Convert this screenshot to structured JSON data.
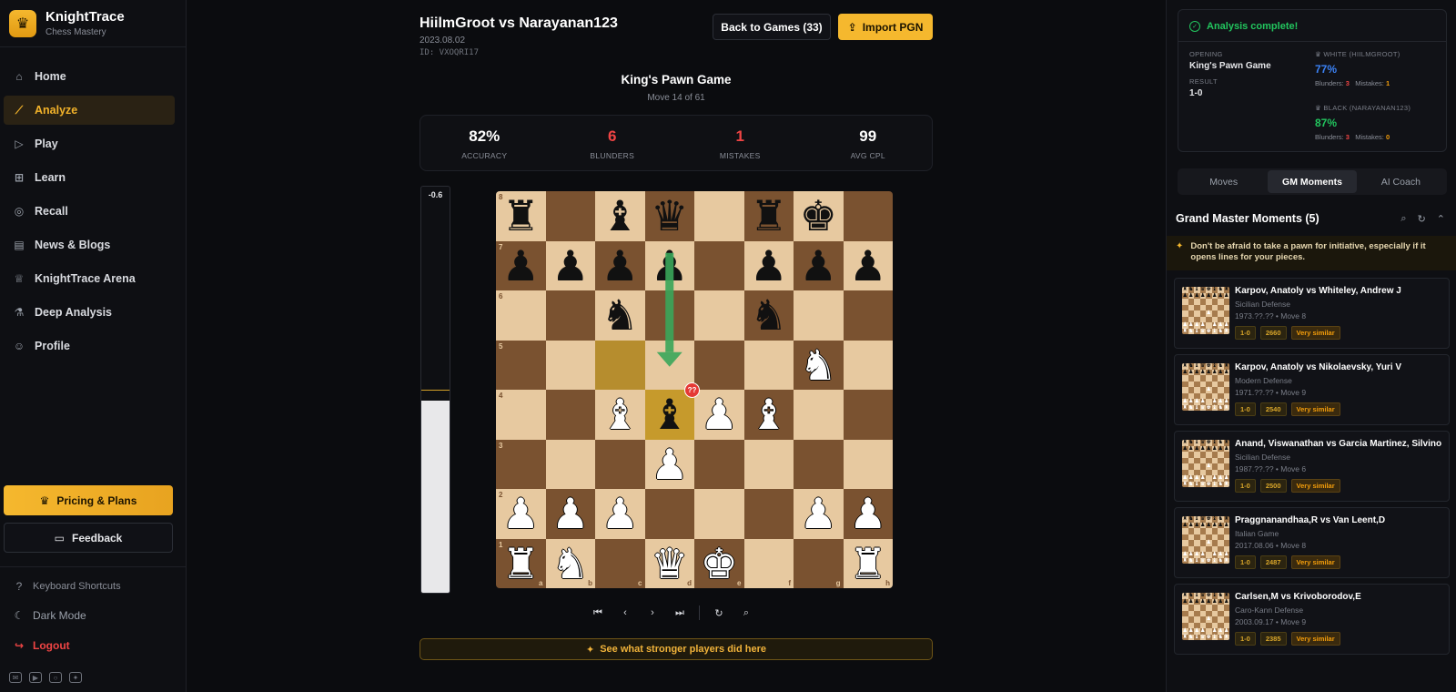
{
  "brand": {
    "title": "KnightTrace",
    "subtitle": "Chess Mastery",
    "logo_icon": "crown-icon"
  },
  "nav": [
    {
      "label": "Home",
      "icon": "home-icon",
      "glyph": "⌂",
      "active": false
    },
    {
      "label": "Analyze",
      "icon": "chart-line-icon",
      "glyph": "⟋",
      "active": true
    },
    {
      "label": "Play",
      "icon": "play-square-icon",
      "glyph": "▷",
      "active": false
    },
    {
      "label": "Learn",
      "icon": "book-icon",
      "glyph": "⊞",
      "active": false
    },
    {
      "label": "Recall",
      "icon": "brain-icon",
      "glyph": "◎",
      "active": false
    },
    {
      "label": "News & Blogs",
      "icon": "newspaper-icon",
      "glyph": "▤",
      "active": false
    },
    {
      "label": "KnightTrace Arena",
      "icon": "trophy-icon",
      "glyph": "♕",
      "active": false
    },
    {
      "label": "Deep Analysis",
      "icon": "microscope-icon",
      "glyph": "⚗",
      "active": false
    },
    {
      "label": "Profile",
      "icon": "user-icon",
      "glyph": "☺",
      "active": false
    }
  ],
  "sidebar": {
    "pricing_label": "Pricing & Plans",
    "feedback_label": "Feedback",
    "shortcuts_label": "Keyboard Shortcuts",
    "dark_mode_label": "Dark Mode",
    "logout_label": "Logout"
  },
  "game": {
    "title": "HiilmGroot vs Narayanan123",
    "date": "2023.08.02",
    "id": "ID: VXOQRI17",
    "back_label": "Back to Games (33)",
    "import_label": "Import PGN",
    "opening": "King's Pawn Game",
    "move_text": "Move 14 of 61"
  },
  "stats": [
    {
      "value": "82%",
      "label": "ACCURACY",
      "red": false
    },
    {
      "value": "6",
      "label": "BLUNDERS",
      "red": true
    },
    {
      "value": "1",
      "label": "MISTAKES",
      "red": true
    },
    {
      "value": "99",
      "label": "AVG CPL",
      "red": false
    }
  ],
  "eval": {
    "value": "-0.6",
    "white_fraction": 0.47
  },
  "board": {
    "ranks": [
      [
        "br",
        "",
        "bb",
        "bq",
        "",
        "br",
        "bk",
        ""
      ],
      [
        "bp",
        "bp",
        "bp",
        "bp",
        "",
        "bp",
        "bp",
        "bp"
      ],
      [
        "",
        "",
        "bn",
        "",
        "",
        "bn",
        "",
        ""
      ],
      [
        "",
        "",
        "",
        "",
        "",
        "",
        "wn",
        ""
      ],
      [
        "",
        "",
        "wb",
        "bb",
        "wp",
        "wb",
        "",
        ""
      ],
      [
        "",
        "",
        "",
        "wp",
        "",
        "",
        "",
        ""
      ],
      [
        "wp",
        "wp",
        "wp",
        "",
        "",
        "",
        "wp",
        "wp"
      ],
      [
        "wr",
        "wn",
        "",
        "wq",
        "wk",
        "",
        "",
        "wr"
      ]
    ],
    "files": [
      "a",
      "b",
      "c",
      "d",
      "e",
      "f",
      "g",
      "h"
    ],
    "rank_labels": [
      "8",
      "7",
      "6",
      "5",
      "4",
      "3",
      "2",
      "1"
    ],
    "highlight_from": "c5",
    "highlight_to": "d4",
    "blunder_badge": "??",
    "arrow": {
      "from": "d7",
      "to": "d5",
      "color": "#3aa65a"
    }
  },
  "see_stronger_label": "See what stronger players did here",
  "analysis": {
    "title": "Analysis complete!",
    "opening_label": "OPENING",
    "opening_value": "King's Pawn Game",
    "result_label": "RESULT",
    "result_value": "1-0",
    "white_label": "WHITE (HIILMGROOT)",
    "white_accuracy": "77%",
    "white_blunders": "3",
    "white_mistakes": "1",
    "black_label": "BLACK (NARAYANAN123)",
    "black_accuracy": "87%",
    "black_blunders": "3",
    "black_mistakes": "0",
    "blunders_word": "Blunders:",
    "mistakes_word": "Mistakes:"
  },
  "tabs": [
    {
      "label": "Moves",
      "active": false
    },
    {
      "label": "GM Moments",
      "active": true
    },
    {
      "label": "AI Coach",
      "active": false
    }
  ],
  "gm": {
    "heading": "Grand Master Moments (5)",
    "tip": "Don't be afraid to take a pawn for initiative, especially if it opens lines for your pieces.",
    "games": [
      {
        "name": "Karpov, Anatoly vs Whiteley, Andrew J",
        "opening": "Sicilian Defense",
        "date": "1973.??.?? • Move 8",
        "result": "1-0",
        "elo": "2660",
        "sim": "Very similar"
      },
      {
        "name": "Karpov, Anatoly vs Nikolaevsky, Yuri V",
        "opening": "Modern Defense",
        "date": "1971.??.?? • Move 9",
        "result": "1-0",
        "elo": "2540",
        "sim": "Very similar"
      },
      {
        "name": "Anand, Viswanathan vs Garcia Martinez, Silvino",
        "opening": "Sicilian Defense",
        "date": "1987.??.?? • Move 6",
        "result": "1-0",
        "elo": "2500",
        "sim": "Very similar"
      },
      {
        "name": "Praggnanandhaa,R vs Van Leent,D",
        "opening": "Italian Game",
        "date": "2017.08.06 • Move 8",
        "result": "1-0",
        "elo": "2487",
        "sim": "Very similar"
      },
      {
        "name": "Carlsen,M vs Krivoborodov,E",
        "opening": "Caro-Kann Defense",
        "date": "2003.09.17 • Move 9",
        "result": "1-0",
        "elo": "2385",
        "sim": "Very similar"
      }
    ]
  }
}
